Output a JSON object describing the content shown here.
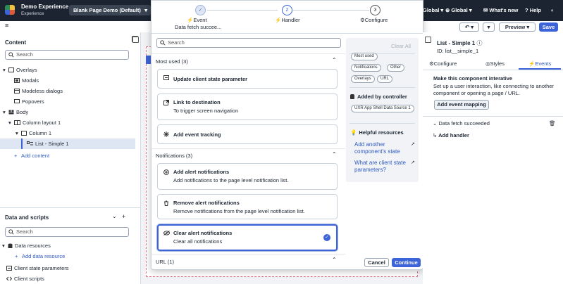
{
  "topbar": {
    "app_name": "Demo Experience",
    "app_subtitle": "Experience",
    "page_selector": "Blank Page Demo (Default)",
    "nav": [
      "Global",
      "Global",
      "What's new",
      "Help"
    ]
  },
  "toolbar": {
    "preview_label": "Preview",
    "save_label": "Save",
    "menu_glyph": "≡"
  },
  "content_panel": {
    "title": "Content",
    "search_placeholder": "Search",
    "tree": [
      {
        "label": "Overlays",
        "depth": 0,
        "icon": "overlays-icon",
        "expanded": true
      },
      {
        "label": "Modals",
        "depth": 1,
        "icon": "modal-icon"
      },
      {
        "label": "Modeless dialogs",
        "depth": 1,
        "icon": "dialog-icon"
      },
      {
        "label": "Popovers",
        "depth": 1,
        "icon": "popover-icon"
      },
      {
        "label": "Body",
        "depth": 0,
        "icon": "body-icon",
        "expanded": true
      },
      {
        "label": "Column layout 1",
        "depth": 1,
        "icon": "columns-icon",
        "expanded": true
      },
      {
        "label": "Column 1",
        "depth": 2,
        "icon": "column-icon",
        "expanded": true
      },
      {
        "label": "List - Simple 1",
        "depth": 3,
        "icon": "list-icon",
        "selected": true
      }
    ],
    "add_content": "Add content"
  },
  "data_panel": {
    "title": "Data and scripts",
    "search_placeholder": "Search",
    "items": [
      "Data resources",
      "Add data resource",
      "Client state parameters",
      "Client scripts"
    ]
  },
  "wizard": {
    "steps": [
      {
        "num": "1",
        "label": "Event",
        "sub": "Data fetch succee...",
        "state": "done"
      },
      {
        "num": "2",
        "label": "Handler",
        "state": "active"
      },
      {
        "num": "3",
        "label": "Configure",
        "state": "pending"
      }
    ],
    "search_placeholder": "Search",
    "clear_all": "Clear All",
    "groups": [
      {
        "title": "Most used (3)",
        "items": [
          {
            "title": "Update client state parameter",
            "subtitle": "",
            "icon": "state-icon"
          },
          {
            "title": "Link to destination",
            "subtitle": "To trigger screen navigation",
            "icon": "link-icon"
          },
          {
            "title": "Add event tracking",
            "subtitle": "",
            "icon": "tracking-icon"
          }
        ]
      },
      {
        "title": "Notifications (3)",
        "items": [
          {
            "title": "Add alert notifications",
            "subtitle": "Add notifications to the page level notification list.",
            "icon": "add-circle-icon"
          },
          {
            "title": "Remove alert notifications",
            "subtitle": "Remove notifications from the page level notification list.",
            "icon": "trash-icon"
          },
          {
            "title": "Clear alert notifications",
            "subtitle": "Clear all notifications",
            "icon": "eye-icon",
            "selected": true
          }
        ]
      },
      {
        "title": "URL (1)",
        "items": []
      }
    ],
    "filter_pills": [
      "Most used",
      "Notifications",
      "Other",
      "Overlays",
      "URL"
    ],
    "added_by_controller": "Added by controller",
    "controller_pill": "UXR App Shell Data Source 1",
    "helpful_title": "Helpful resources",
    "helpful_links": [
      "Add another component's state",
      "What are client state parameters?"
    ],
    "cancel_label": "Cancel",
    "continue_label": "Continue"
  },
  "inspector": {
    "title": "List - Simple 1",
    "id_label": "ID: list__simple_1",
    "tabs": [
      "Configure",
      "Styles",
      "Events"
    ],
    "active_tab": "Events",
    "heading": "Make this component interative",
    "description": "Set up a user interaction, like connecting to another component or opening a page / URL.",
    "add_event_button": "Add event mapping",
    "event_name": "Data fetch succeeded",
    "add_handler": "Add handler"
  },
  "colors": {
    "accent": "#3c63d8",
    "topbar": "#1b2430",
    "link": "#2f5ac2",
    "selected_row": "#dfe6f3"
  }
}
